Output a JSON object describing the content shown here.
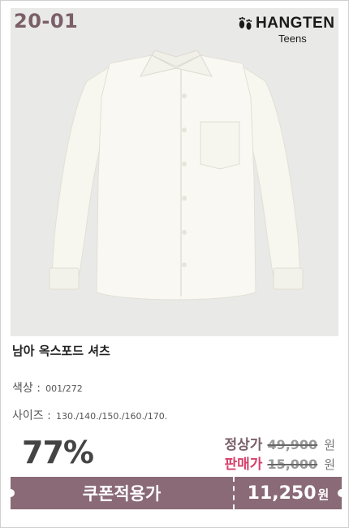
{
  "product": {
    "code": "20-01",
    "brand_main": "HANGTEN",
    "brand_sub": "Teens",
    "title": "남아 옥스포드 셔츠",
    "color_label": "색상 :",
    "color_value": "001/272",
    "size_label": "사이즈 :",
    "size_value": "130./140./150./160./170."
  },
  "pricing": {
    "discount": "77%",
    "normal_label": "정상가",
    "normal_value": "49,900",
    "sale_label": "판매가",
    "sale_value": "15,000",
    "won": "원",
    "coupon_label": "쿠폰적용가",
    "coupon_value": "11,250",
    "coupon_won": "원"
  },
  "colors": {
    "accent": "#8a6a76",
    "sale": "#d6416b",
    "photo_bg": "#e9e9e7"
  }
}
